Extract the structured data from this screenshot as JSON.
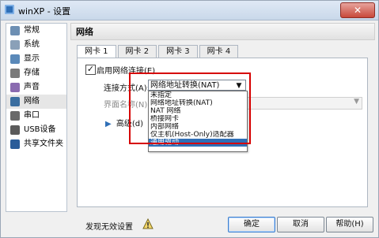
{
  "window": {
    "title": "winXP - 设置",
    "close_label": "✕",
    "app_icon": "virtualbox-icon"
  },
  "sidebar": {
    "items": [
      {
        "label": "常规",
        "icon": "general-icon",
        "color": "#6d8fb3"
      },
      {
        "label": "系统",
        "icon": "system-icon",
        "color": "#8aa0b8"
      },
      {
        "label": "显示",
        "icon": "display-icon",
        "color": "#5a89b9"
      },
      {
        "label": "存储",
        "icon": "storage-icon",
        "color": "#7a7a7a"
      },
      {
        "label": "声音",
        "icon": "sound-icon",
        "color": "#8a6bb0"
      },
      {
        "label": "网络",
        "icon": "network-icon",
        "color": "#3b6ea0"
      },
      {
        "label": "串口",
        "icon": "serial-port-icon",
        "color": "#6a6a6a"
      },
      {
        "label": "USB设备",
        "icon": "usb-icon",
        "color": "#5b5b5b"
      },
      {
        "label": "共享文件夹",
        "icon": "shared-folder-icon",
        "color": "#2a5c99"
      }
    ],
    "selected_index": 5
  },
  "page": {
    "title": "网络",
    "tabs": [
      "网卡 1",
      "网卡 2",
      "网卡 3",
      "网卡 4"
    ],
    "active_tab": 0,
    "enable_label": "启用网络连接(E)",
    "enable_checked": true,
    "connection_label": "连接方式(A):",
    "connection_selected": "网络地址转换(NAT)",
    "interface_label": "界面名称(N):",
    "advanced_label": "高级(d)",
    "dropdown_options": [
      "未指定",
      "网络地址转换(NAT)",
      "NAT 网络",
      "桥接网卡",
      "内部网络",
      "仅主机(Host-Only)适配器",
      "通用驱动"
    ],
    "dropdown_selected_index": 6
  },
  "bottom": {
    "invalid_settings_label": "发现无效设置",
    "ok_label": "确定",
    "cancel_label": "取消",
    "help_label": "帮助(H)"
  },
  "colors": {
    "accent": "#2f6fb7",
    "highlight_box": "#d60000"
  }
}
